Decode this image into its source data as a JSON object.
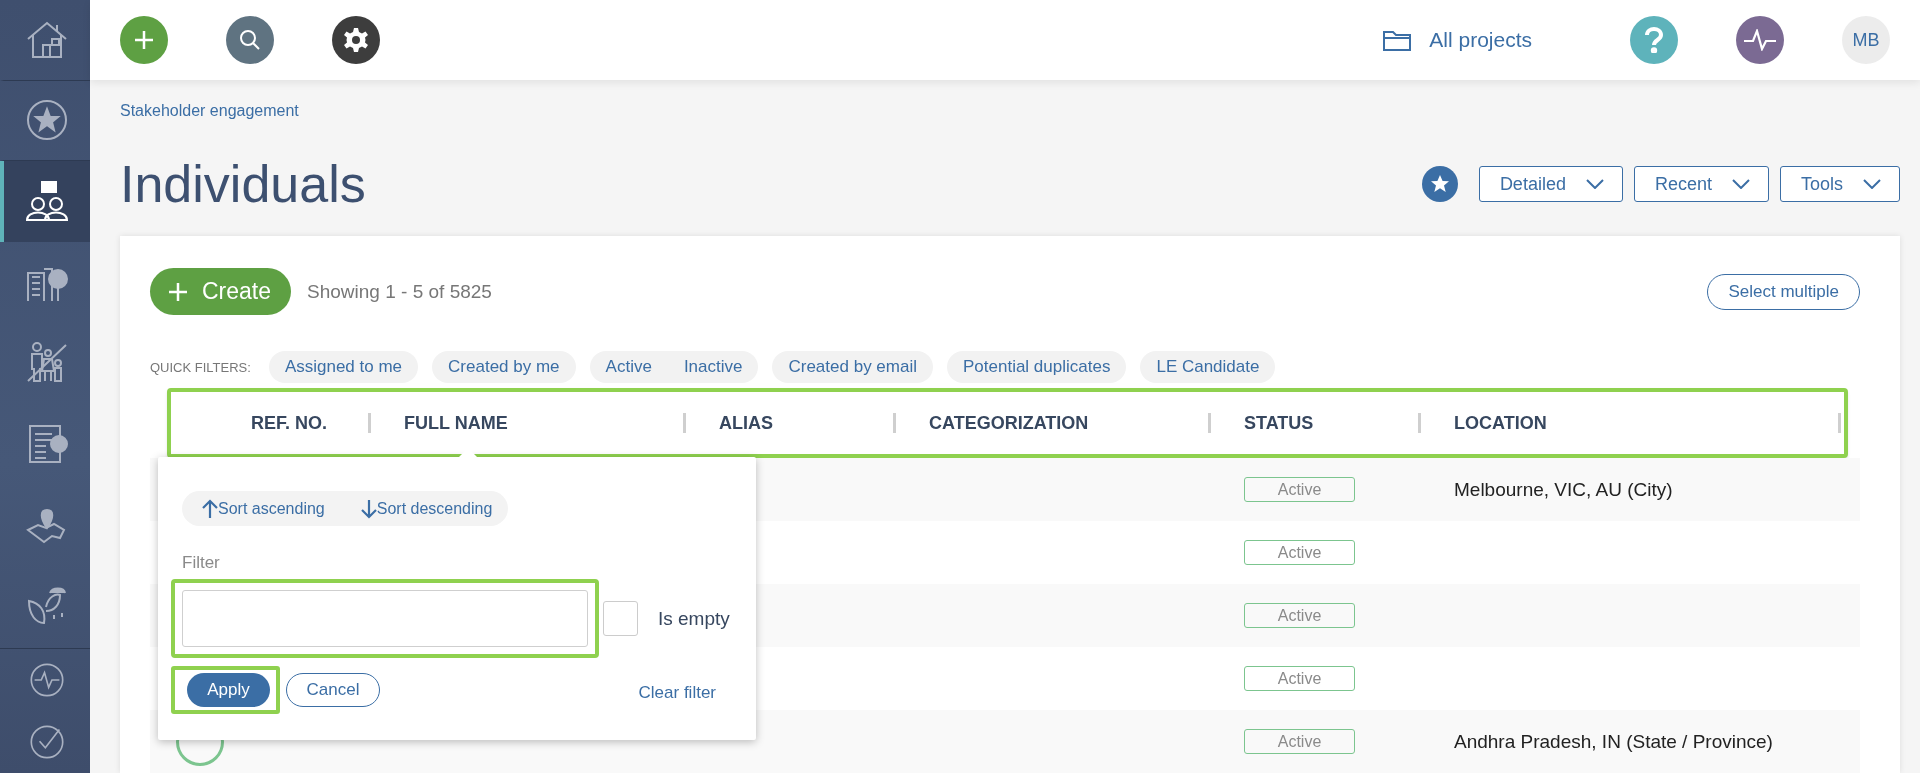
{
  "sidebar": {
    "items": [
      {
        "kind": "home",
        "selected": false
      },
      {
        "kind": "star",
        "selected": false
      },
      {
        "kind": "people",
        "selected": true
      },
      {
        "kind": "buildings",
        "selected": false
      },
      {
        "kind": "family",
        "selected": false
      },
      {
        "kind": "clipboard",
        "selected": false
      },
      {
        "kind": "map",
        "selected": false
      },
      {
        "kind": "leaves",
        "selected": false
      }
    ],
    "bottom_items": [
      {
        "kind": "pulse",
        "selected": false
      },
      {
        "kind": "check",
        "selected": false
      }
    ]
  },
  "topbar": {
    "project_selector": "All projects",
    "user_initials": "MB"
  },
  "breadcrumb": "Stakeholder engagement",
  "page_title": "Individuals",
  "view_buttons": [
    "Detailed",
    "Recent",
    "Tools"
  ],
  "toolbar": {
    "create": "Create",
    "summary": "Showing 1 - 5 of 5825",
    "select_multiple": "Select multiple"
  },
  "quick_filters": {
    "label": "QUICK FILTERS:",
    "groups": [
      {
        "options": [
          "Assigned to me"
        ]
      },
      {
        "options": [
          "Created by me"
        ]
      },
      {
        "options": [
          "Active",
          "Inactive"
        ]
      },
      {
        "options": [
          "Created by email"
        ]
      },
      {
        "options": [
          "Potential duplicates"
        ]
      },
      {
        "options": [
          "LE Candidate"
        ]
      }
    ]
  },
  "table": {
    "columns": [
      "REF. NO.",
      "FULL NAME",
      "ALIAS",
      "CATEGORIZATION",
      "STATUS",
      "LOCATION"
    ],
    "rows": [
      {
        "status": "Active",
        "location": "Melbourne, VIC, AU (City)"
      },
      {
        "status": "Active"
      },
      {
        "status": "Active"
      },
      {
        "status": "Active"
      },
      {
        "avatar": true,
        "status": "Active",
        "location": "Andhra Pradesh, IN (State / Province)"
      }
    ]
  },
  "filter_popup": {
    "sort_ascending": "Sort ascending",
    "sort_descending": "Sort descending",
    "label": "Filter",
    "is_empty": {
      "label": "Is empty",
      "checked": false
    },
    "apply": "Apply",
    "cancel": "Cancel",
    "clear": "Clear filter"
  }
}
